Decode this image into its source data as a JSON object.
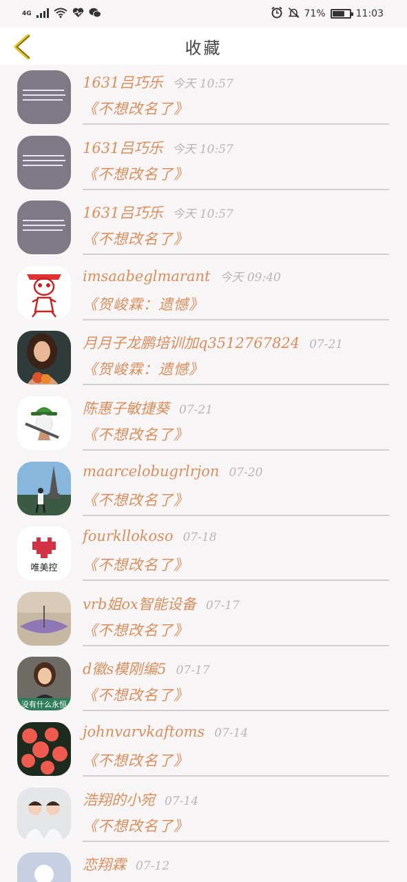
{
  "status": {
    "network": "4G",
    "battery": "71%",
    "time": "11:03",
    "battery_level": 0.71
  },
  "nav": {
    "title": "收藏",
    "back_icon": "chevron-left-icon",
    "accent": "#e5c21a"
  },
  "items": [
    {
      "name": "1631吕巧乐",
      "time": "今天 10:57",
      "title": "《不想改名了》",
      "avatar": "text-image"
    },
    {
      "name": "1631吕巧乐",
      "time": "今天 10:57",
      "title": "《不想改名了》",
      "avatar": "text-image"
    },
    {
      "name": "1631吕巧乐",
      "time": "今天 10:57",
      "title": "《不想改名了》",
      "avatar": "text-image"
    },
    {
      "name": "imsaabeglmarant",
      "time": "今天 09:40",
      "title": "《贺峻霖：遗憾》",
      "avatar": "skull-sketch"
    },
    {
      "name": "月月子龙鹏培训加q3512767824",
      "time": "07-21",
      "title": "《贺峻霖：遗憾》",
      "avatar": "girl-photo"
    },
    {
      "name": "陈惠子敏捷葵",
      "time": "07-21",
      "title": "《不想改名了》",
      "avatar": "bucket-hat"
    },
    {
      "name": "maarcelobugrlrjon",
      "time": "07-20",
      "title": "《不想改名了》",
      "avatar": "eiffel-photo"
    },
    {
      "name": "fourkllokoso",
      "time": "07-18",
      "title": "《不想改名了》",
      "avatar": "heart-logo",
      "avatar_text": "唯美控"
    },
    {
      "name": "vrb姐ox智能设备",
      "time": "07-17",
      "title": "《不想改名了》",
      "avatar": "umbrella-photo"
    },
    {
      "name": "d徽s模刚编5",
      "time": "07-17",
      "title": "《不想改名了》",
      "avatar": "woman-photo",
      "avatar_text": "没有什么永恒"
    },
    {
      "name": "johnvarvkaftoms",
      "time": "07-14",
      "title": "《不想改名了》",
      "avatar": "flowers-photo"
    },
    {
      "name": "浩翔的小宛",
      "time": "07-14",
      "title": "《不想改名了》",
      "avatar": "boys-photo"
    },
    {
      "name": "恋翔霖",
      "time": "07-12",
      "title": "",
      "avatar": "default-avatar"
    }
  ]
}
